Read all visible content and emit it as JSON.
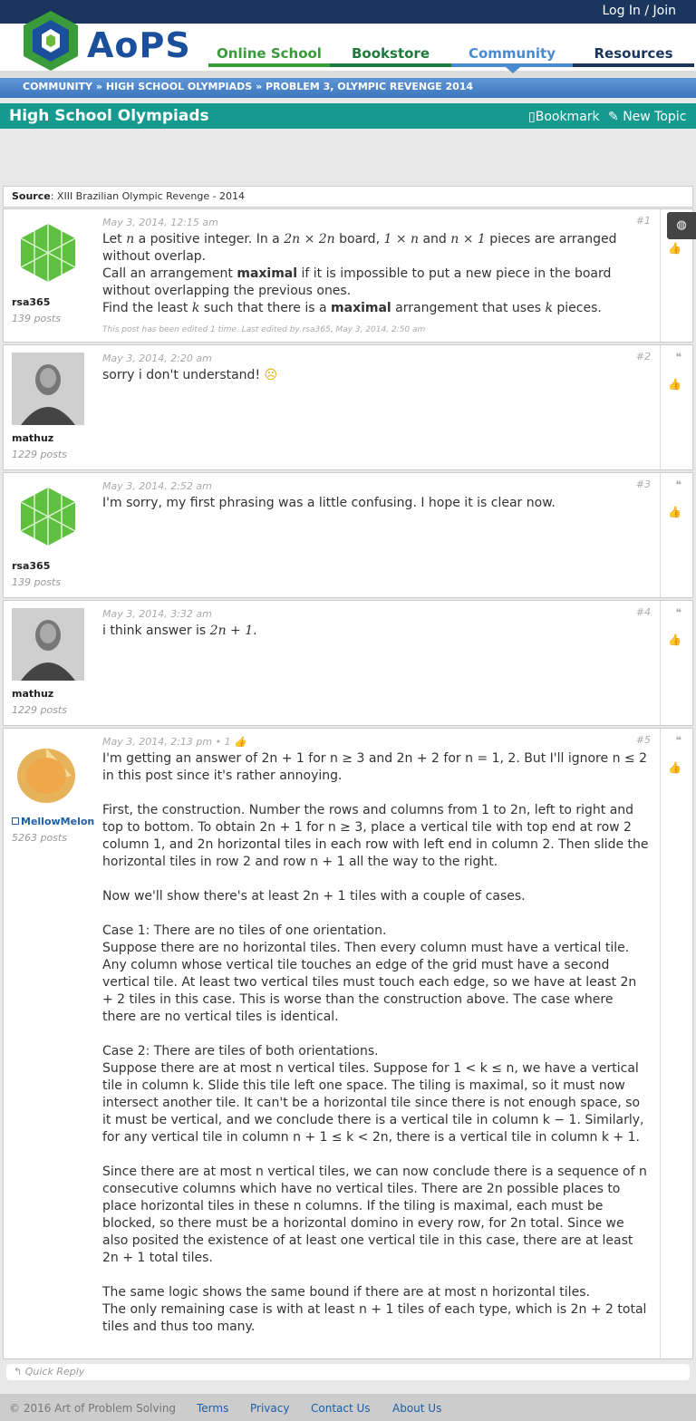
{
  "topbar": {
    "login": "Log In / Join"
  },
  "logo": {
    "text": "AoPS"
  },
  "nav": {
    "online_school": "Online School",
    "bookstore": "Bookstore",
    "community": "Community",
    "resources": "Resources"
  },
  "breadcrumb": {
    "c1": "COMMUNITY",
    "sep": "»",
    "c2": "HIGH SCHOOL OLYMPIADS",
    "c3": "PROBLEM 3, OLYMPIC REVENGE 2014"
  },
  "forum": {
    "title": "High School Olympiads",
    "bookmark": "Bookmark",
    "new_topic": "New Topic"
  },
  "source": {
    "label": "Source",
    "value": ": XIII Brazilian Olympic Revenge - 2014"
  },
  "posts": [
    {
      "user": "rsa365",
      "count": "139 posts",
      "date": "May 3, 2014, 12:15 am",
      "num": "#1",
      "l1a": "Let ",
      "l1b": "n",
      "l1c": " a positive integer. In a ",
      "l1d": "2n × 2n",
      "l1e": " board, ",
      "l1f": "1 × n",
      "l1g": " and ",
      "l1h": "n × 1",
      "l1i": " pieces are arranged without overlap.",
      "l2a": "Call an arrangement ",
      "l2b": "maximal",
      "l2c": " if it is impossible to put a new piece in the board without overlapping the previous ones.",
      "l3a": "Find the least ",
      "l3b": "k",
      "l3c": " such that there is a ",
      "l3d": "maximal",
      "l3e": " arrangement that uses ",
      "l3f": "k",
      "l3g": " pieces.",
      "edited": "This post has been edited 1 time. Last edited by rsa365, May 3, 2014, 2:50 am"
    },
    {
      "user": "mathuz",
      "count": "1229 posts",
      "date": "May 3, 2014, 2:20 am",
      "num": "#2",
      "text": "sorry i don't understand!"
    },
    {
      "user": "rsa365",
      "count": "139 posts",
      "date": "May 3, 2014, 2:52 am",
      "num": "#3",
      "text": "I'm sorry, my first phrasing was a little confusing. I hope it is clear now."
    },
    {
      "user": "mathuz",
      "count": "1229 posts",
      "date": "May 3, 2014, 3:32 am",
      "num": "#4",
      "text_a": "i think answer is ",
      "text_b": "2n + 1",
      "text_c": "."
    },
    {
      "user": "MellowMelon",
      "count": "5263 posts",
      "date": "May 3, 2014, 2:13 pm",
      "likes": "• 1",
      "num": "#5",
      "p1": "I'm getting an answer of 2n + 1 for n ≥ 3 and 2n + 2 for n = 1, 2. But I'll ignore n ≤ 2 in this post since it's rather annoying.",
      "p2": "First, the construction. Number the rows and columns from 1 to 2n, left to right and top to bottom. To obtain 2n + 1 for n ≥ 3, place a vertical tile with top end at row 2 column 1, and 2n horizontal tiles in each row with left end in column 2. Then slide the horizontal tiles in row 2 and row n + 1 all the way to the right.",
      "p3": "Now we'll show there's at least 2n + 1 tiles with a couple of cases.",
      "p4": "Case 1: There are no tiles of one orientation.",
      "p5": "Suppose there are no horizontal tiles. Then every column must have a vertical tile. Any column whose vertical tile touches an edge of the grid must have a second vertical tile. At least two vertical tiles must touch each edge, so we have at least 2n + 2 tiles in this case. This is worse than the construction above. The case where there are no vertical tiles is identical.",
      "p6": "Case 2: There are tiles of both orientations.",
      "p7": "Suppose there are at most n vertical tiles. Suppose for 1 < k ≤ n, we have a vertical tile in column k. Slide this tile left one space. The tiling is maximal, so it must now intersect another tile. It can't be a horizontal tile since there is not enough space, so it must be vertical, and we conclude there is a vertical tile in column k − 1. Similarly, for any vertical tile in column n + 1 ≤ k < 2n, there is a vertical tile in column k + 1.",
      "p8": "Since there are at most n vertical tiles, we can now conclude there is a sequence of n consecutive columns which have no vertical tiles. There are 2n possible places to place horizontal tiles in these n columns. If the tiling is maximal, each must be blocked, so there must be a horizontal domino in every row, for 2n total. Since we also posited the existence of at least one vertical tile in this case, there are at least 2n + 1 total tiles.",
      "p9": "The same logic shows the same bound if there are at most n horizontal tiles.",
      "p10": "The only remaining case is with at least n + 1 tiles of each type, which is 2n + 2 total tiles and thus too many."
    }
  ],
  "quick_reply": "Quick Reply",
  "footer": {
    "copy": "© 2016 Art of Problem Solving",
    "terms": "Terms",
    "privacy": "Privacy",
    "contact": "Contact Us",
    "about": "About Us"
  },
  "colors": {
    "navy": "#1b365d",
    "teal": "#16998f",
    "link": "#1b5fa8"
  }
}
